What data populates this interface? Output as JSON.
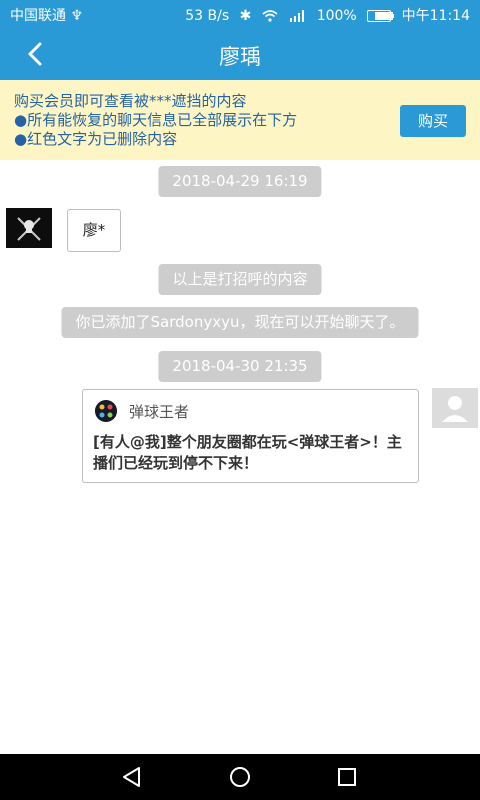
{
  "status": {
    "carrier": "中国联通 ♆",
    "speed": "53 B/s",
    "icons": [
      "bluetooth-icon",
      "wifi-icon",
      "4g-signal-icon"
    ],
    "battery": "100%",
    "battery_level": 1.0,
    "time": "中午11:14"
  },
  "header": {
    "title": "廖瑀",
    "back_icon": "chevron-left-icon"
  },
  "banner": {
    "line1": "购买会员即可查看被***遮挡的内容",
    "line2": "●所有能恢复的聊天信息已全部展示在下方",
    "line3": "●红色文字为已删除内容",
    "buy_label": "购买",
    "background": "#fdf5c3",
    "text_color": "#2563a6"
  },
  "messages": {
    "time1": "2018-04-29 16:19",
    "name_msg": "廖*",
    "greeting_notice": "以上是打招呼的内容",
    "added_notice": "你已添加了Sardonyxyu，现在可以开始聊天了。",
    "time2": "2018-04-30 21:35",
    "card": {
      "app_name": "弹球王者",
      "text": "[有人@我]整个朋友圈都在玩<弹球王者>！主播们已经玩到停不下来！"
    }
  },
  "navbar": {
    "icons": [
      "back-triangle-icon",
      "home-circle-icon",
      "recents-square-icon"
    ]
  },
  "colors": {
    "accent": "#2a9ad6",
    "timestamp_bg": "#cdcdcd"
  }
}
